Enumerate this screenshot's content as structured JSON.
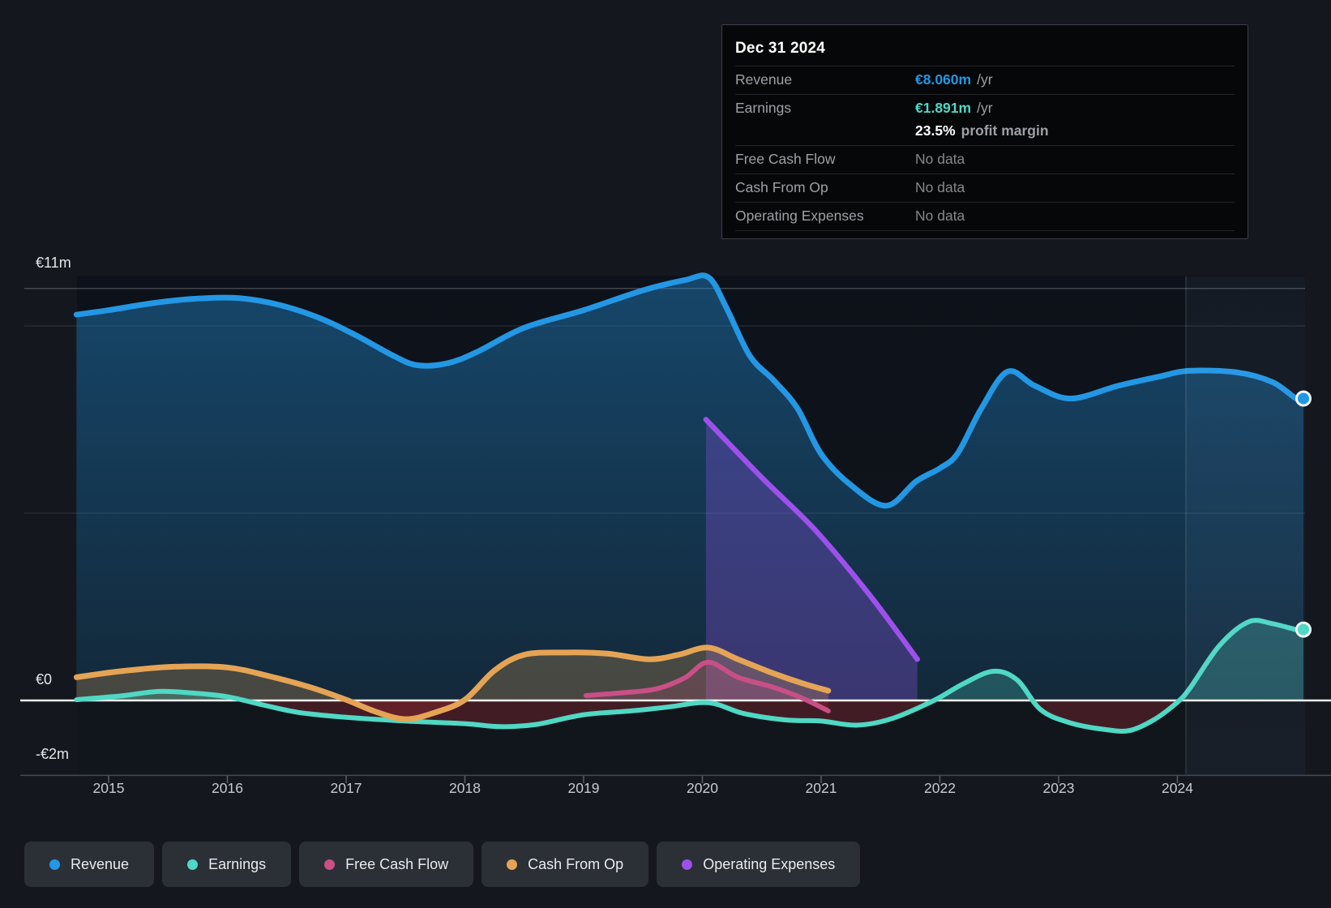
{
  "tooltip": {
    "title": "Dec 31 2024",
    "rows": [
      {
        "label": "Revenue",
        "value": "€8.060m",
        "suffix": "/yr",
        "style": "revenue"
      },
      {
        "label": "Earnings",
        "value": "€1.891m",
        "suffix": "/yr",
        "style": "earnings"
      },
      {
        "label": "",
        "value": "23.5%",
        "suffix": "profit margin",
        "style": "margin"
      },
      {
        "label": "Free Cash Flow",
        "value": "No data",
        "suffix": "",
        "style": "nodata"
      },
      {
        "label": "Cash From Op",
        "value": "No data",
        "suffix": "",
        "style": "nodata"
      },
      {
        "label": "Operating Expenses",
        "value": "No data",
        "suffix": "",
        "style": "nodata"
      }
    ]
  },
  "legend": [
    {
      "key": "revenue",
      "label": "Revenue",
      "color": "#2397e4"
    },
    {
      "key": "earnings",
      "label": "Earnings",
      "color": "#4fd8c4"
    },
    {
      "key": "fcf",
      "label": "Free Cash Flow",
      "color": "#c94f87"
    },
    {
      "key": "cashop",
      "label": "Cash From Op",
      "color": "#e5a455"
    },
    {
      "key": "opex",
      "label": "Operating Expenses",
      "color": "#9d50eb"
    }
  ],
  "chart_data": {
    "type": "area",
    "unit": "EUR millions per year",
    "x_ticks": [
      2015,
      2016,
      2017,
      2018,
      2019,
      2020,
      2021,
      2022,
      2023,
      2024
    ],
    "y_axis": {
      "top_label": "€11m",
      "zero_label": "€0",
      "bottom_label": "-€2m",
      "gridline_values_m": [
        11,
        10,
        5,
        0,
        -2
      ],
      "range_m": [
        -2,
        11
      ]
    },
    "end_date": "Dec 31 2024",
    "series": [
      {
        "key": "revenue",
        "name": "Revenue",
        "end_label": "€8.060m",
        "marker_at_end": true,
        "extend": true,
        "points": [
          [
            2014.73,
            10.3
          ],
          [
            2015.0,
            10.42
          ],
          [
            2015.4,
            10.62
          ],
          [
            2015.75,
            10.73
          ],
          [
            2016.1,
            10.74
          ],
          [
            2016.45,
            10.55
          ],
          [
            2016.8,
            10.18
          ],
          [
            2017.1,
            9.72
          ],
          [
            2017.4,
            9.2
          ],
          [
            2017.6,
            8.95
          ],
          [
            2017.85,
            9.0
          ],
          [
            2018.1,
            9.3
          ],
          [
            2018.5,
            9.95
          ],
          [
            2019.0,
            10.42
          ],
          [
            2019.5,
            10.95
          ],
          [
            2019.85,
            11.22
          ],
          [
            2020.05,
            11.3
          ],
          [
            2020.2,
            10.5
          ],
          [
            2020.4,
            9.2
          ],
          [
            2020.6,
            8.55
          ],
          [
            2020.8,
            7.8
          ],
          [
            2021.0,
            6.58
          ],
          [
            2021.25,
            5.75
          ],
          [
            2021.55,
            5.2
          ],
          [
            2021.8,
            5.85
          ],
          [
            2022.0,
            6.2
          ],
          [
            2022.15,
            6.6
          ],
          [
            2022.35,
            7.8
          ],
          [
            2022.57,
            8.78
          ],
          [
            2022.8,
            8.4
          ],
          [
            2023.1,
            8.06
          ],
          [
            2023.5,
            8.4
          ],
          [
            2023.85,
            8.65
          ],
          [
            2024.1,
            8.8
          ],
          [
            2024.5,
            8.76
          ],
          [
            2024.8,
            8.5
          ],
          [
            2025.0,
            8.06
          ]
        ]
      },
      {
        "key": "earnings",
        "name": "Earnings",
        "end_label": "€1.891m",
        "marker_at_end": true,
        "extend": true,
        "points": [
          [
            2014.73,
            0.02
          ],
          [
            2015.1,
            0.12
          ],
          [
            2015.42,
            0.24
          ],
          [
            2015.7,
            0.2
          ],
          [
            2016.0,
            0.1
          ],
          [
            2016.3,
            -0.12
          ],
          [
            2016.6,
            -0.32
          ],
          [
            2017.0,
            -0.45
          ],
          [
            2017.5,
            -0.55
          ],
          [
            2018.0,
            -0.62
          ],
          [
            2018.3,
            -0.7
          ],
          [
            2018.6,
            -0.64
          ],
          [
            2019.0,
            -0.38
          ],
          [
            2019.4,
            -0.28
          ],
          [
            2019.7,
            -0.18
          ],
          [
            2020.05,
            -0.06
          ],
          [
            2020.35,
            -0.35
          ],
          [
            2020.7,
            -0.52
          ],
          [
            2021.0,
            -0.55
          ],
          [
            2021.3,
            -0.66
          ],
          [
            2021.6,
            -0.48
          ],
          [
            2021.95,
            0.0
          ],
          [
            2022.2,
            0.45
          ],
          [
            2022.45,
            0.78
          ],
          [
            2022.65,
            0.55
          ],
          [
            2022.85,
            -0.25
          ],
          [
            2023.1,
            -0.6
          ],
          [
            2023.4,
            -0.78
          ],
          [
            2023.6,
            -0.8
          ],
          [
            2023.8,
            -0.52
          ],
          [
            2023.98,
            -0.1
          ],
          [
            2024.1,
            0.3
          ],
          [
            2024.35,
            1.45
          ],
          [
            2024.6,
            2.1
          ],
          [
            2024.8,
            2.05
          ],
          [
            2025.0,
            1.891
          ]
        ]
      },
      {
        "key": "cashop",
        "name": "Cash From Op",
        "marker_at_end": false,
        "extend": false,
        "points": [
          [
            2014.73,
            0.62
          ],
          [
            2015.1,
            0.78
          ],
          [
            2015.55,
            0.9
          ],
          [
            2016.0,
            0.88
          ],
          [
            2016.35,
            0.65
          ],
          [
            2016.7,
            0.35
          ],
          [
            2017.0,
            0.02
          ],
          [
            2017.25,
            -0.3
          ],
          [
            2017.5,
            -0.5
          ],
          [
            2017.75,
            -0.32
          ],
          [
            2018.0,
            0.02
          ],
          [
            2018.25,
            0.8
          ],
          [
            2018.5,
            1.22
          ],
          [
            2018.85,
            1.28
          ],
          [
            2019.2,
            1.25
          ],
          [
            2019.55,
            1.1
          ],
          [
            2019.8,
            1.22
          ],
          [
            2020.05,
            1.41
          ],
          [
            2020.3,
            1.1
          ],
          [
            2020.6,
            0.72
          ],
          [
            2020.85,
            0.45
          ],
          [
            2021.06,
            0.26
          ]
        ]
      },
      {
        "key": "fcf",
        "name": "Free Cash Flow",
        "marker_at_end": false,
        "extend": false,
        "points": [
          [
            2019.02,
            0.13
          ],
          [
            2019.3,
            0.2
          ],
          [
            2019.6,
            0.3
          ],
          [
            2019.85,
            0.6
          ],
          [
            2020.05,
            1.02
          ],
          [
            2020.3,
            0.62
          ],
          [
            2020.6,
            0.35
          ],
          [
            2020.85,
            0.05
          ],
          [
            2021.06,
            -0.28
          ]
        ]
      },
      {
        "key": "opex",
        "name": "Operating Expenses",
        "marker_at_end": false,
        "extend": false,
        "points": [
          [
            2020.03,
            7.5
          ],
          [
            2020.5,
            5.95
          ],
          [
            2020.95,
            4.55
          ],
          [
            2021.4,
            2.85
          ],
          [
            2021.81,
            1.1
          ]
        ]
      }
    ]
  }
}
